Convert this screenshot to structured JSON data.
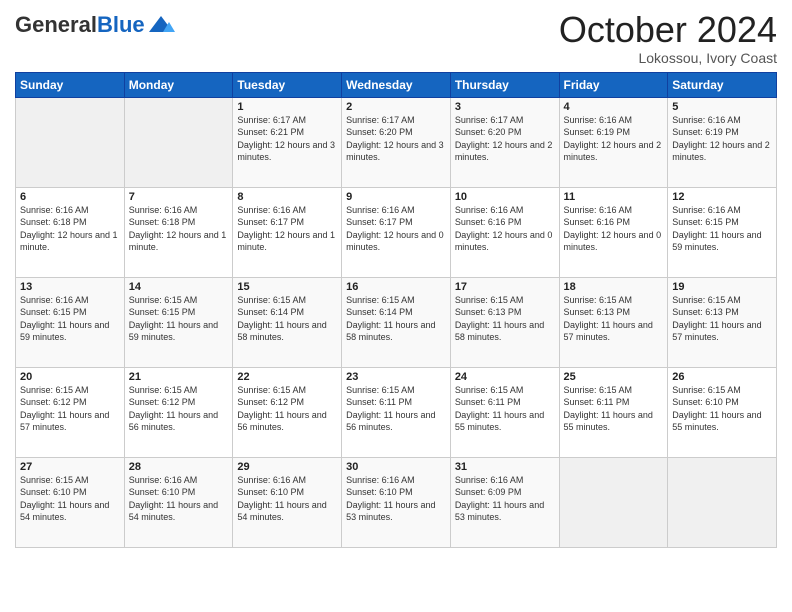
{
  "header": {
    "logo_line1": "General",
    "logo_line2": "Blue",
    "month": "October 2024",
    "location": "Lokossou, Ivory Coast"
  },
  "days_of_week": [
    "Sunday",
    "Monday",
    "Tuesday",
    "Wednesday",
    "Thursday",
    "Friday",
    "Saturday"
  ],
  "weeks": [
    [
      {
        "date": "",
        "sunrise": "",
        "sunset": "",
        "daylight": "",
        "empty": true
      },
      {
        "date": "",
        "sunrise": "",
        "sunset": "",
        "daylight": "",
        "empty": true
      },
      {
        "date": "1",
        "sunrise": "Sunrise: 6:17 AM",
        "sunset": "Sunset: 6:21 PM",
        "daylight": "Daylight: 12 hours and 3 minutes."
      },
      {
        "date": "2",
        "sunrise": "Sunrise: 6:17 AM",
        "sunset": "Sunset: 6:20 PM",
        "daylight": "Daylight: 12 hours and 3 minutes."
      },
      {
        "date": "3",
        "sunrise": "Sunrise: 6:17 AM",
        "sunset": "Sunset: 6:20 PM",
        "daylight": "Daylight: 12 hours and 2 minutes."
      },
      {
        "date": "4",
        "sunrise": "Sunrise: 6:16 AM",
        "sunset": "Sunset: 6:19 PM",
        "daylight": "Daylight: 12 hours and 2 minutes."
      },
      {
        "date": "5",
        "sunrise": "Sunrise: 6:16 AM",
        "sunset": "Sunset: 6:19 PM",
        "daylight": "Daylight: 12 hours and 2 minutes."
      }
    ],
    [
      {
        "date": "6",
        "sunrise": "Sunrise: 6:16 AM",
        "sunset": "Sunset: 6:18 PM",
        "daylight": "Daylight: 12 hours and 1 minute."
      },
      {
        "date": "7",
        "sunrise": "Sunrise: 6:16 AM",
        "sunset": "Sunset: 6:18 PM",
        "daylight": "Daylight: 12 hours and 1 minute."
      },
      {
        "date": "8",
        "sunrise": "Sunrise: 6:16 AM",
        "sunset": "Sunset: 6:17 PM",
        "daylight": "Daylight: 12 hours and 1 minute."
      },
      {
        "date": "9",
        "sunrise": "Sunrise: 6:16 AM",
        "sunset": "Sunset: 6:17 PM",
        "daylight": "Daylight: 12 hours and 0 minutes."
      },
      {
        "date": "10",
        "sunrise": "Sunrise: 6:16 AM",
        "sunset": "Sunset: 6:16 PM",
        "daylight": "Daylight: 12 hours and 0 minutes."
      },
      {
        "date": "11",
        "sunrise": "Sunrise: 6:16 AM",
        "sunset": "Sunset: 6:16 PM",
        "daylight": "Daylight: 12 hours and 0 minutes."
      },
      {
        "date": "12",
        "sunrise": "Sunrise: 6:16 AM",
        "sunset": "Sunset: 6:15 PM",
        "daylight": "Daylight: 11 hours and 59 minutes."
      }
    ],
    [
      {
        "date": "13",
        "sunrise": "Sunrise: 6:16 AM",
        "sunset": "Sunset: 6:15 PM",
        "daylight": "Daylight: 11 hours and 59 minutes."
      },
      {
        "date": "14",
        "sunrise": "Sunrise: 6:15 AM",
        "sunset": "Sunset: 6:15 PM",
        "daylight": "Daylight: 11 hours and 59 minutes."
      },
      {
        "date": "15",
        "sunrise": "Sunrise: 6:15 AM",
        "sunset": "Sunset: 6:14 PM",
        "daylight": "Daylight: 11 hours and 58 minutes."
      },
      {
        "date": "16",
        "sunrise": "Sunrise: 6:15 AM",
        "sunset": "Sunset: 6:14 PM",
        "daylight": "Daylight: 11 hours and 58 minutes."
      },
      {
        "date": "17",
        "sunrise": "Sunrise: 6:15 AM",
        "sunset": "Sunset: 6:13 PM",
        "daylight": "Daylight: 11 hours and 58 minutes."
      },
      {
        "date": "18",
        "sunrise": "Sunrise: 6:15 AM",
        "sunset": "Sunset: 6:13 PM",
        "daylight": "Daylight: 11 hours and 57 minutes."
      },
      {
        "date": "19",
        "sunrise": "Sunrise: 6:15 AM",
        "sunset": "Sunset: 6:13 PM",
        "daylight": "Daylight: 11 hours and 57 minutes."
      }
    ],
    [
      {
        "date": "20",
        "sunrise": "Sunrise: 6:15 AM",
        "sunset": "Sunset: 6:12 PM",
        "daylight": "Daylight: 11 hours and 57 minutes."
      },
      {
        "date": "21",
        "sunrise": "Sunrise: 6:15 AM",
        "sunset": "Sunset: 6:12 PM",
        "daylight": "Daylight: 11 hours and 56 minutes."
      },
      {
        "date": "22",
        "sunrise": "Sunrise: 6:15 AM",
        "sunset": "Sunset: 6:12 PM",
        "daylight": "Daylight: 11 hours and 56 minutes."
      },
      {
        "date": "23",
        "sunrise": "Sunrise: 6:15 AM",
        "sunset": "Sunset: 6:11 PM",
        "daylight": "Daylight: 11 hours and 56 minutes."
      },
      {
        "date": "24",
        "sunrise": "Sunrise: 6:15 AM",
        "sunset": "Sunset: 6:11 PM",
        "daylight": "Daylight: 11 hours and 55 minutes."
      },
      {
        "date": "25",
        "sunrise": "Sunrise: 6:15 AM",
        "sunset": "Sunset: 6:11 PM",
        "daylight": "Daylight: 11 hours and 55 minutes."
      },
      {
        "date": "26",
        "sunrise": "Sunrise: 6:15 AM",
        "sunset": "Sunset: 6:10 PM",
        "daylight": "Daylight: 11 hours and 55 minutes."
      }
    ],
    [
      {
        "date": "27",
        "sunrise": "Sunrise: 6:15 AM",
        "sunset": "Sunset: 6:10 PM",
        "daylight": "Daylight: 11 hours and 54 minutes."
      },
      {
        "date": "28",
        "sunrise": "Sunrise: 6:16 AM",
        "sunset": "Sunset: 6:10 PM",
        "daylight": "Daylight: 11 hours and 54 minutes."
      },
      {
        "date": "29",
        "sunrise": "Sunrise: 6:16 AM",
        "sunset": "Sunset: 6:10 PM",
        "daylight": "Daylight: 11 hours and 54 minutes."
      },
      {
        "date": "30",
        "sunrise": "Sunrise: 6:16 AM",
        "sunset": "Sunset: 6:10 PM",
        "daylight": "Daylight: 11 hours and 53 minutes."
      },
      {
        "date": "31",
        "sunrise": "Sunrise: 6:16 AM",
        "sunset": "Sunset: 6:09 PM",
        "daylight": "Daylight: 11 hours and 53 minutes."
      },
      {
        "date": "",
        "sunrise": "",
        "sunset": "",
        "daylight": "",
        "empty": true
      },
      {
        "date": "",
        "sunrise": "",
        "sunset": "",
        "daylight": "",
        "empty": true
      }
    ]
  ]
}
